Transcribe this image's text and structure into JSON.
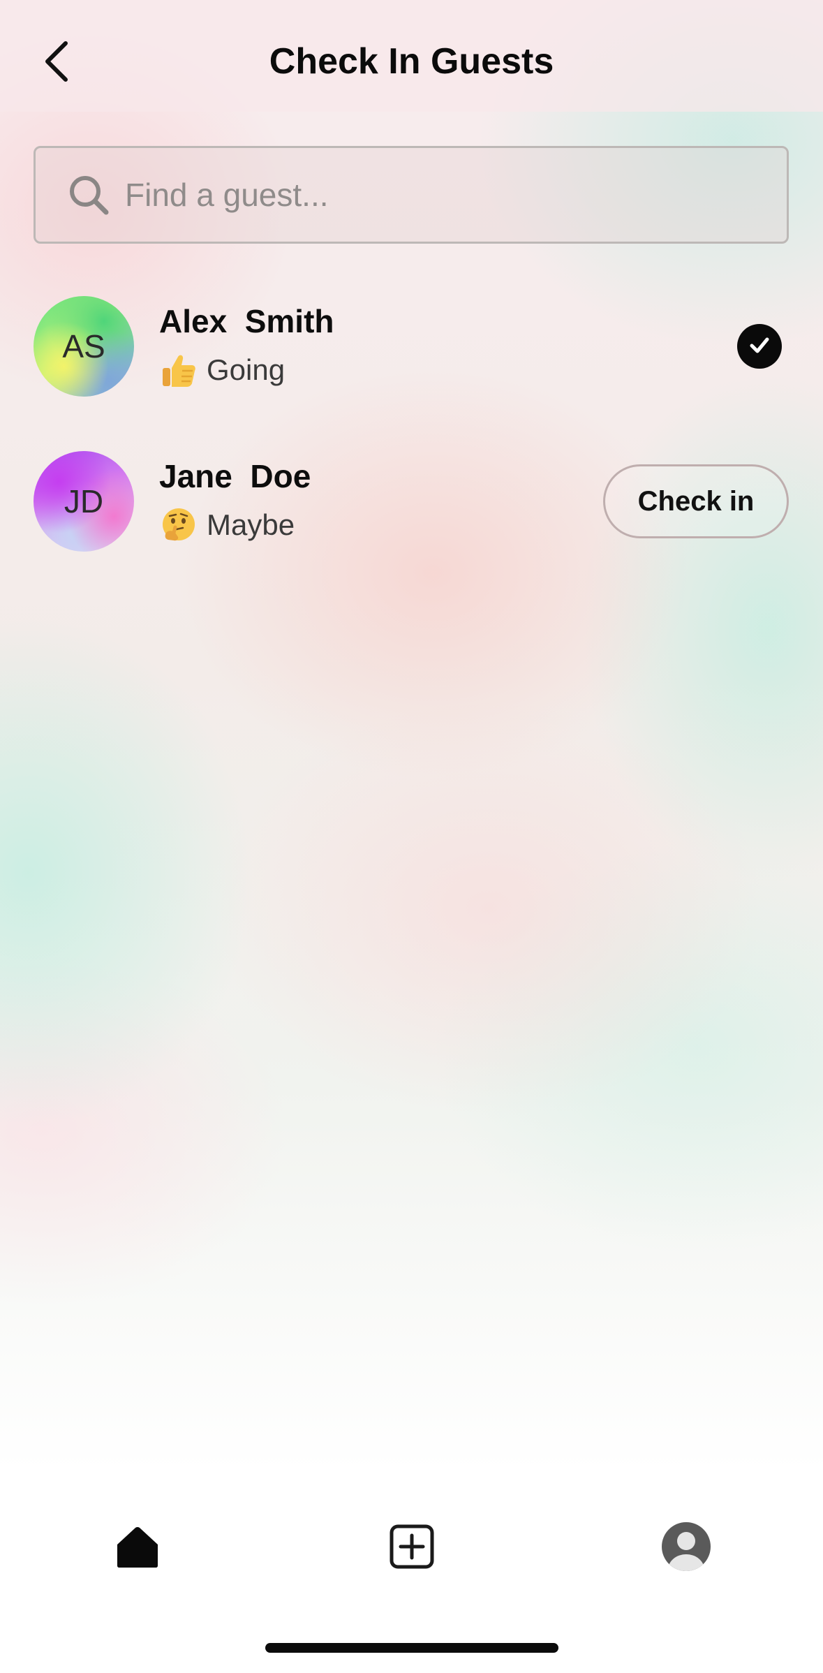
{
  "header": {
    "title": "Check In Guests",
    "back_icon": "chevron-left-icon"
  },
  "search": {
    "placeholder": "Find a guest...",
    "value": "",
    "icon": "search-icon"
  },
  "guests": [
    {
      "initials": "AS",
      "name": "Alex  Smith",
      "status_emoji": "thumbs-up-icon",
      "status": "Going",
      "checked_in": true
    },
    {
      "initials": "JD",
      "name": "Jane  Doe",
      "status_emoji": "thinking-face-icon",
      "status": "Maybe",
      "checked_in": false,
      "action_label": "Check in"
    }
  ],
  "tab_bar": {
    "items": [
      {
        "icon": "home-icon",
        "active": true
      },
      {
        "icon": "add-square-icon",
        "active": false
      },
      {
        "icon": "profile-icon",
        "active": false
      }
    ]
  },
  "colors": {
    "text": "#111111",
    "badge": "#0a0a0a",
    "search_border": "#bdb8b6",
    "button_border": "#bfaeae"
  }
}
